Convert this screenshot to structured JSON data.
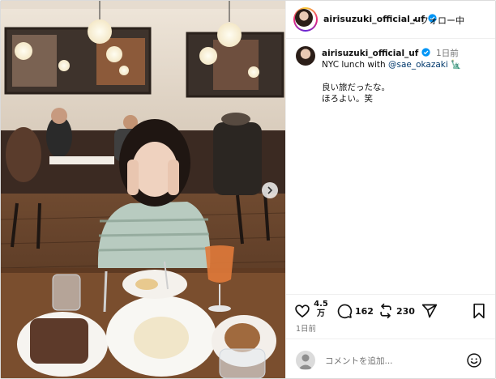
{
  "account": {
    "username": "airisuzuki_official_uf",
    "follow_label": "フォロー中"
  },
  "caption": {
    "username": "airisuzuki_official_uf",
    "time_ago": "1日前",
    "line1_prefix": "NYC lunch with ",
    "mention": "@sae_okazaki",
    "line1_emoji": "🗽",
    "line2": "良い旅だったな。",
    "line3": "ほろよい。笑"
  },
  "actions": {
    "likes_top": "4.5",
    "likes_bottom": "万",
    "comments": "162",
    "reposts": "230"
  },
  "posted_ago": "1日前",
  "comment_box": {
    "placeholder": "コメントを追加..."
  },
  "icons": {
    "verified": "verified-badge-icon",
    "like": "heart-icon",
    "comment": "comment-icon",
    "repost": "repost-icon",
    "share": "paper-plane-icon",
    "save": "bookmark-icon",
    "emoji": "smiley-icon",
    "next": "chevron-right-icon"
  },
  "colors": {
    "verified_blue": "#0095f6",
    "mention": "#00376b",
    "muted": "#737373"
  }
}
